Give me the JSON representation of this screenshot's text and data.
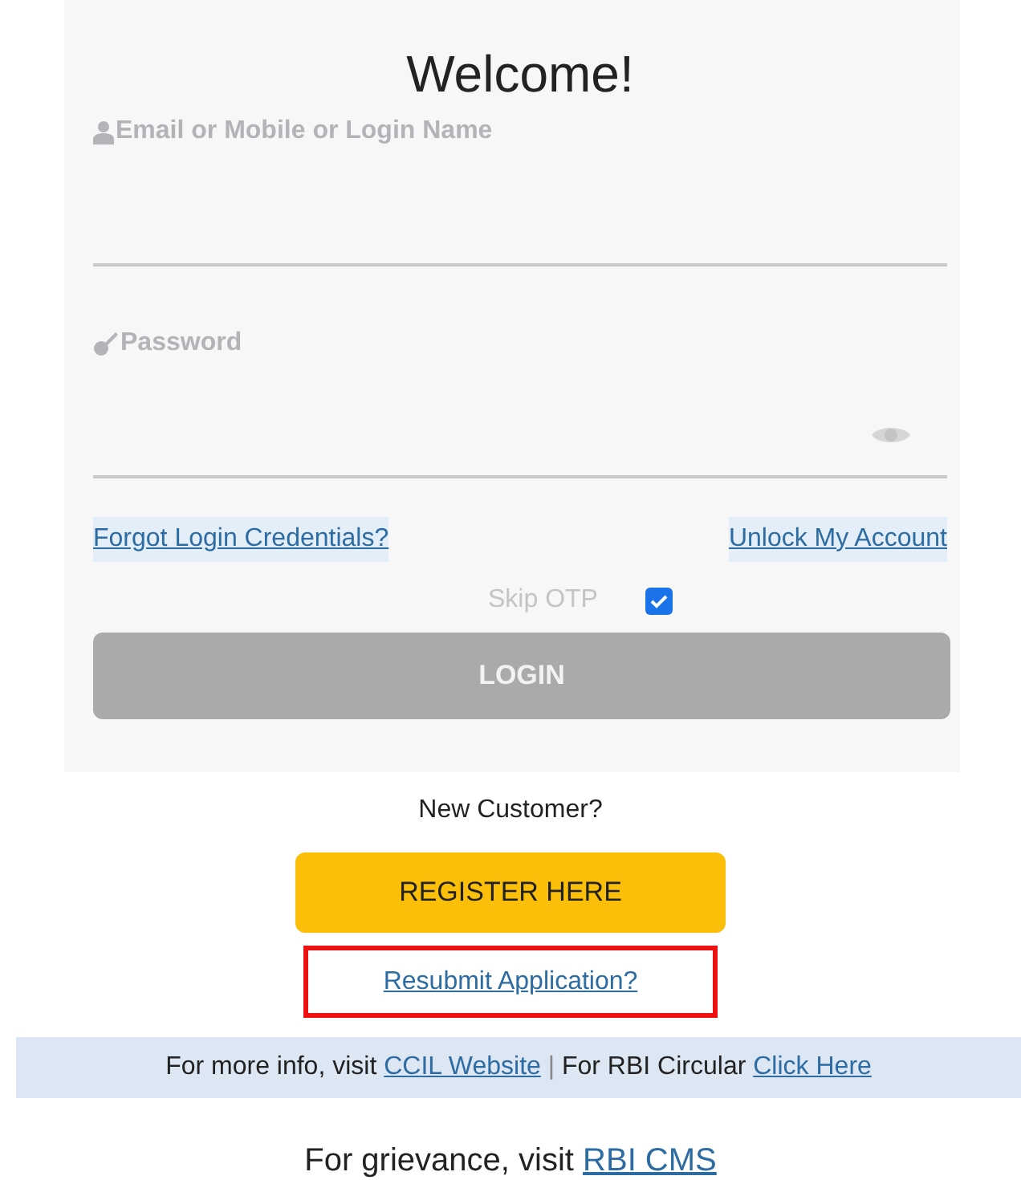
{
  "login_panel": {
    "title": "Welcome!",
    "fields": [
      {
        "kind": "user",
        "label": "Email or Mobile or Login Name"
      },
      {
        "kind": "password",
        "label": "Password"
      }
    ],
    "links": [
      {
        "text": "Forgot Login Credentials?"
      },
      {
        "text": "Unlock My Account"
      }
    ],
    "skip_otp": {
      "label": "Skip OTP",
      "checked": true
    },
    "login_button": {
      "text": "LOGIN",
      "disabled": true
    }
  },
  "new_customer": {
    "prompt": "New Customer?",
    "register_button": "REGISTER HERE",
    "resubmit_link": {
      "text": "Resubmit Application?",
      "highlighted": true
    }
  },
  "info_bar": [
    {
      "kind": "text",
      "text": "For more info, visit"
    },
    {
      "kind": "link",
      "text": "CCIL Website"
    },
    {
      "kind": "separator",
      "text": "|"
    },
    {
      "kind": "text",
      "text": "For RBI Circular"
    },
    {
      "kind": "link",
      "text": "Click Here"
    }
  ],
  "grievance": [
    {
      "kind": "text",
      "text": "For grievance, visit"
    },
    {
      "kind": "link",
      "text": "RBI CMS"
    }
  ]
}
